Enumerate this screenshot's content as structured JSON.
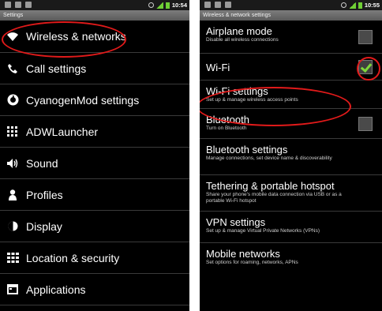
{
  "left": {
    "status_time": "10:54",
    "title": "Settings",
    "items": [
      {
        "label": "Wireless & networks",
        "icon": "wifi-icon"
      },
      {
        "label": "Call settings",
        "icon": "phone-icon"
      },
      {
        "label": "CyanogenMod settings",
        "icon": "cyanogenmod-icon"
      },
      {
        "label": "ADWLauncher",
        "icon": "grid-icon"
      },
      {
        "label": "Sound",
        "icon": "speaker-icon"
      },
      {
        "label": "Profiles",
        "icon": "person-icon"
      },
      {
        "label": "Display",
        "icon": "contrast-icon"
      },
      {
        "label": "Location & security",
        "icon": "location-grid-icon"
      },
      {
        "label": "Applications",
        "icon": "applications-icon"
      }
    ]
  },
  "right": {
    "status_time": "10:55",
    "title": "Wireless & network settings",
    "settings": [
      {
        "title": "Airplane mode",
        "summary": "Disable all wireless connections",
        "checkbox": true,
        "checked": false
      },
      {
        "title": "Wi-Fi",
        "summary": "",
        "checkbox": true,
        "checked": true
      },
      {
        "title": "Wi-Fi settings",
        "summary": "Set up & manage wireless access points",
        "checkbox": false
      },
      {
        "title": "Bluetooth",
        "summary": "Turn on Bluetooth",
        "checkbox": true,
        "checked": false
      },
      {
        "title": "Bluetooth settings",
        "summary": "Manage connections, set device name & discoverability",
        "checkbox": false
      },
      {
        "title": "Tethering & portable hotspot",
        "summary": "Share your phone's mobile data connection via USB or as a portable Wi-Fi hotspot",
        "checkbox": false
      },
      {
        "title": "VPN settings",
        "summary": "Set up & manage Virtual Private Networks (VPNs)",
        "checkbox": false
      },
      {
        "title": "Mobile networks",
        "summary": "Set options for roaming, networks, APNs",
        "checkbox": false
      }
    ]
  },
  "colors": {
    "background": "#000000",
    "highlight_circle": "#e11a1a",
    "check_green": "#7fd83a"
  }
}
